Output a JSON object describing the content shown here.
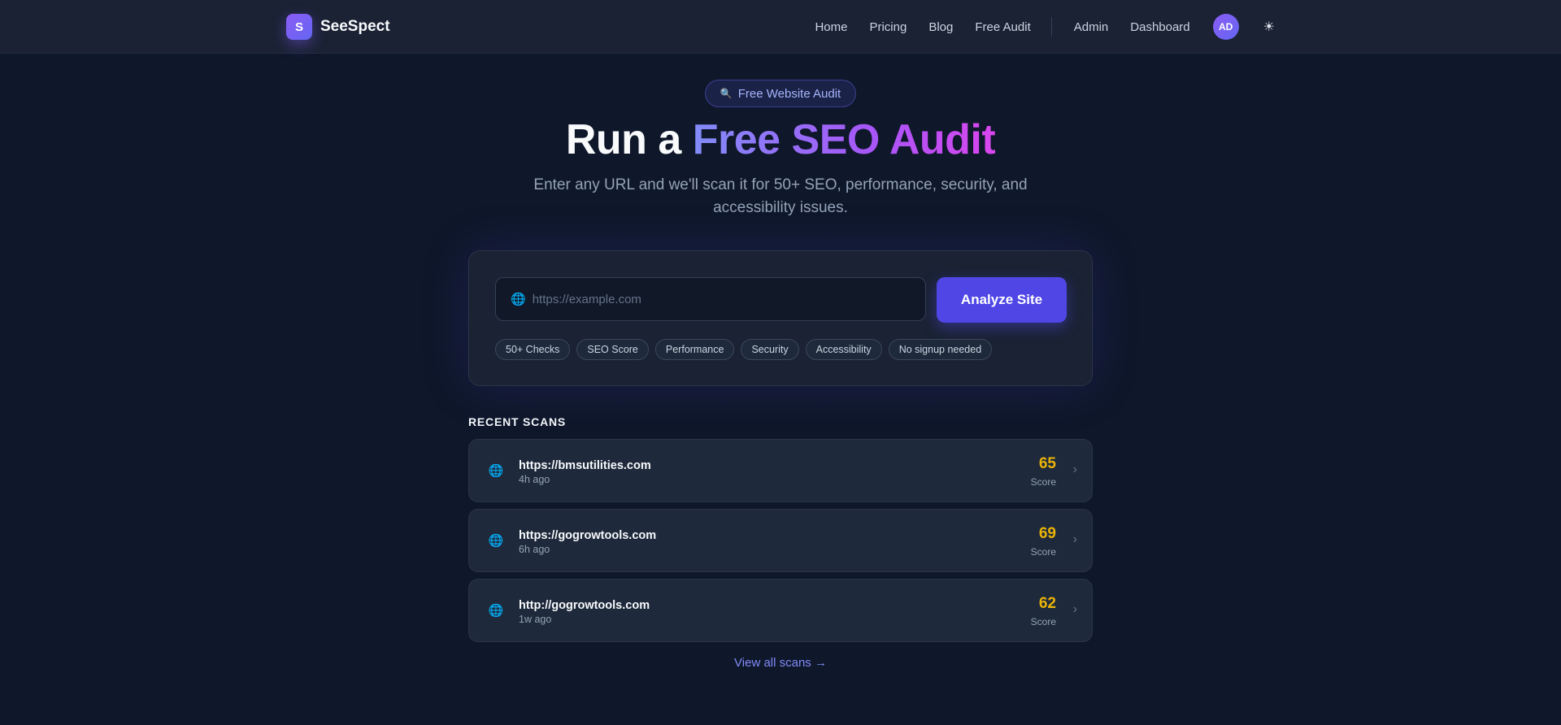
{
  "brand": {
    "logo_letter": "S",
    "name": "SeeSpect"
  },
  "nav": {
    "links": [
      "Home",
      "Pricing",
      "Blog",
      "Free Audit"
    ],
    "admin": "Admin",
    "dashboard": "Dashboard",
    "avatar_initials": "AD",
    "theme_icon": "☀"
  },
  "hero": {
    "badge_icon": "🔍",
    "badge": "Free Website Audit",
    "title_prefix": "Run a ",
    "title_highlight": "Free SEO Audit",
    "subtitle": "Enter any URL and we'll scan it for 50+ SEO, performance, security, and accessibility issues."
  },
  "audit": {
    "input_icon": "🌐",
    "input_value": "",
    "input_placeholder": "https://example.com",
    "button": "Analyze Site",
    "tags": [
      "50+ Checks",
      "SEO Score",
      "Performance",
      "Security",
      "Accessibility",
      "No signup needed"
    ]
  },
  "recent": {
    "heading": "RECENT SCANS",
    "score_label": "Score",
    "scans": [
      {
        "url": "https://bmsutilities.com",
        "time": "4h ago",
        "score": "65"
      },
      {
        "url": "https://gogrowtools.com",
        "time": "6h ago",
        "score": "69"
      },
      {
        "url": "http://gogrowtools.com",
        "time": "1w ago",
        "score": "62"
      }
    ],
    "view_all": "View all scans →"
  },
  "colors": {
    "background": "#0f172a",
    "accent": "#4f46e5",
    "score": "#eab308",
    "link": "#818cf8"
  }
}
